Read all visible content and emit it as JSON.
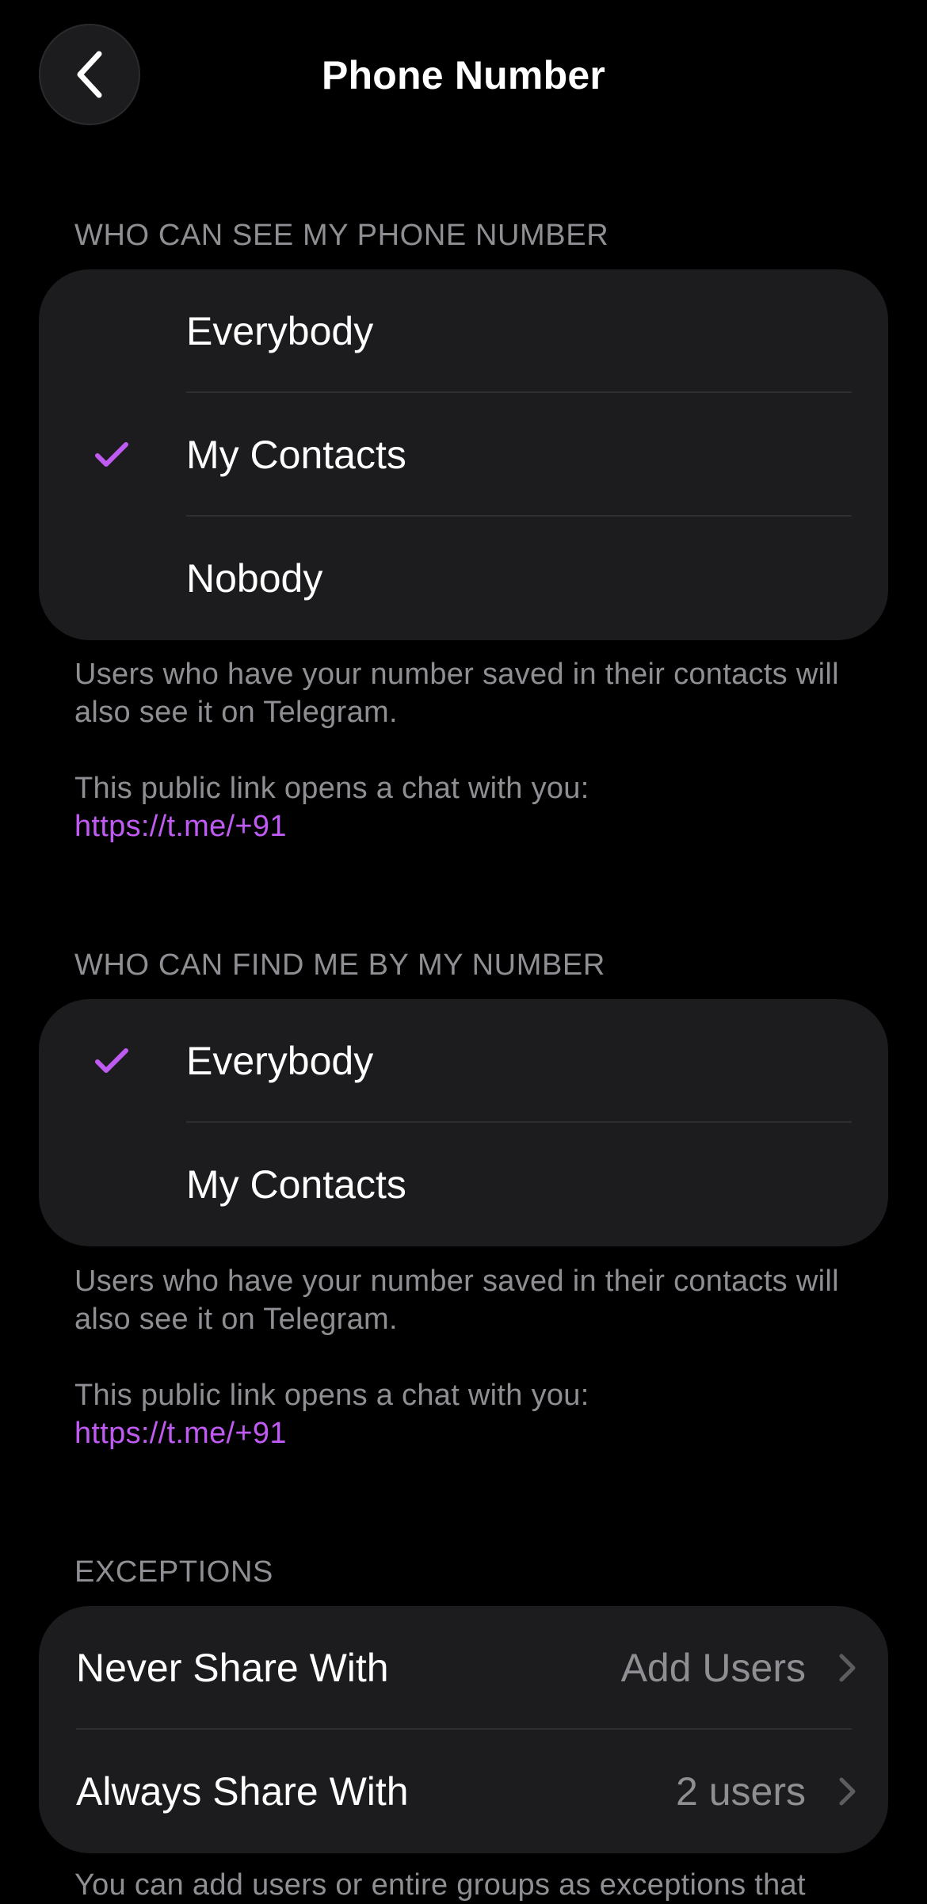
{
  "header": {
    "title": "Phone Number",
    "back_icon": "chevron-left-icon"
  },
  "colors": {
    "accent": "#bf5af2",
    "background": "#000000",
    "group_bg": "#1c1c1e",
    "secondary_text": "#8e8e93",
    "divider": "#2e2e31"
  },
  "see_section": {
    "title": "WHO CAN SEE MY PHONE NUMBER",
    "options": [
      {
        "label": "Everybody",
        "selected": false
      },
      {
        "label": "My Contacts",
        "selected": true
      },
      {
        "label": "Nobody",
        "selected": false
      }
    ],
    "footnote": "Users who have your number saved in their contacts will also see it on Telegram.",
    "link_caption": "This public link opens a chat with you:",
    "link_text": "https://t.me/+91"
  },
  "find_section": {
    "title": "WHO CAN FIND ME BY MY NUMBER",
    "options": [
      {
        "label": "Everybody",
        "selected": true
      },
      {
        "label": "My Contacts",
        "selected": false
      }
    ],
    "footnote": "Users who have your number saved in their contacts will also see it on Telegram.",
    "link_caption": "This public link opens a chat with you:",
    "link_text": "https://t.me/+91"
  },
  "exceptions": {
    "title": "EXCEPTIONS",
    "rows": [
      {
        "label": "Never Share With",
        "value": "Add Users"
      },
      {
        "label": "Always Share With",
        "value": "2 users"
      }
    ],
    "footnote": "You can add users or entire groups as exceptions that"
  }
}
